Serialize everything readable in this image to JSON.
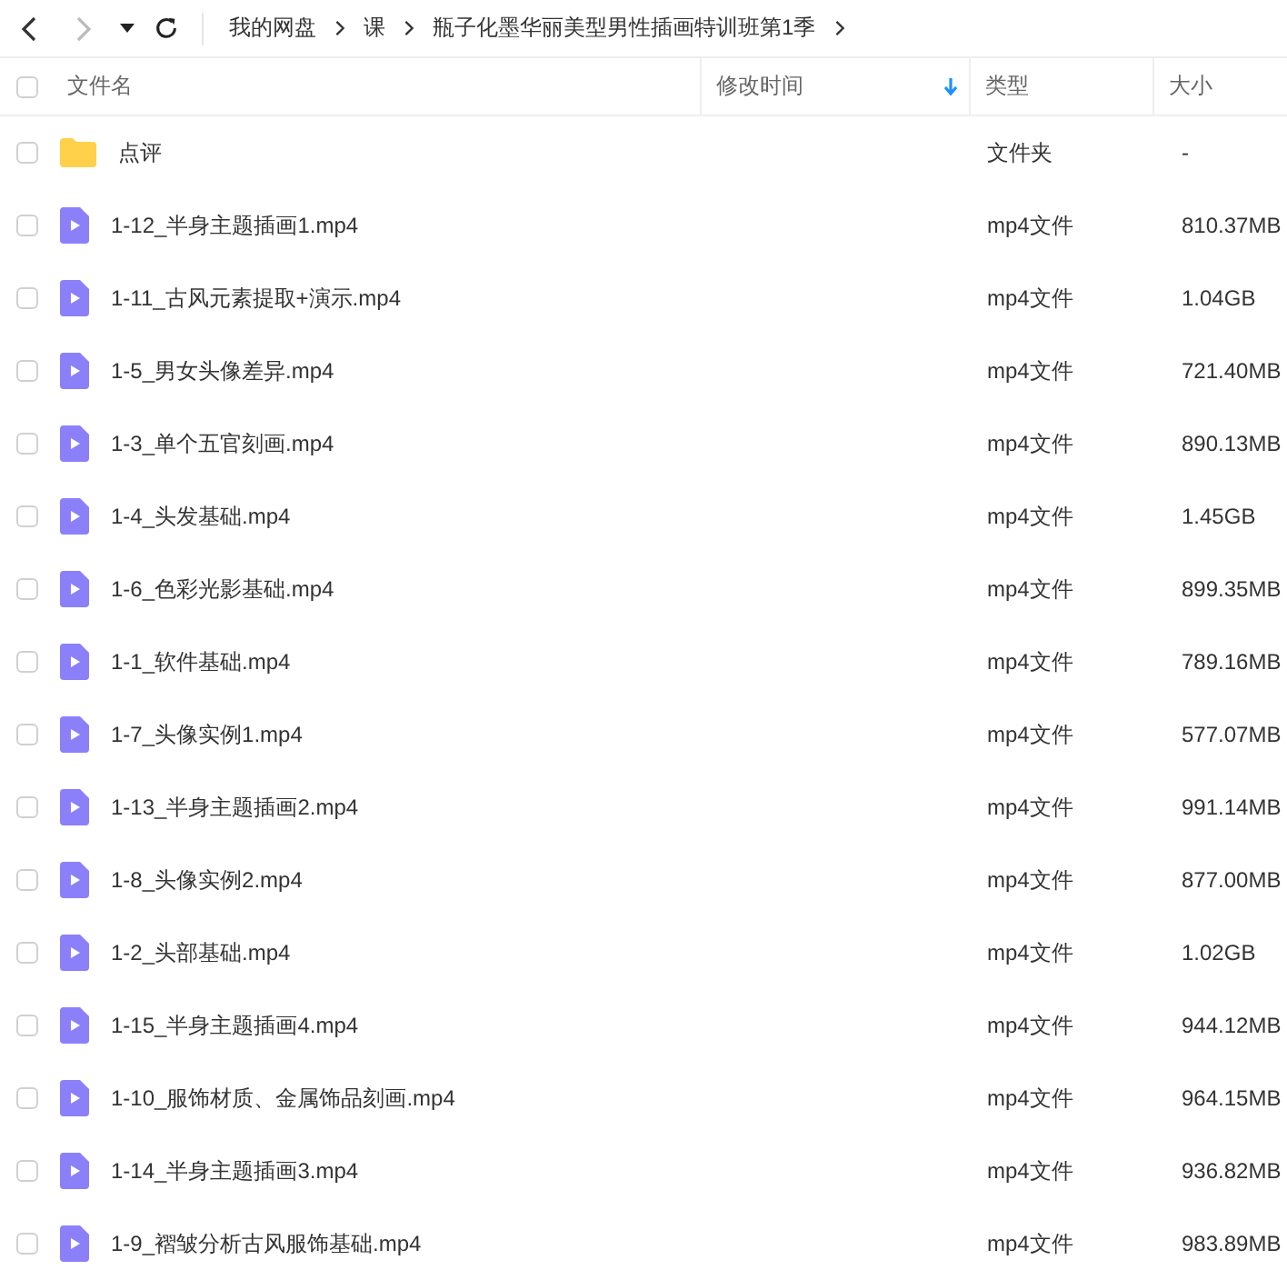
{
  "toolbar": {
    "back_disabled": false,
    "forward_disabled": true
  },
  "breadcrumb": [
    "我的网盘",
    "课",
    "瓶子化墨华丽美型男性插画特训班第1季"
  ],
  "select_all": false,
  "columns": [
    {
      "label": "文件名",
      "sorted": false
    },
    {
      "label": "修改时间",
      "sorted": true
    },
    {
      "label": "类型",
      "sorted": false
    },
    {
      "label": "大小",
      "sorted": false
    }
  ],
  "rows": [
    {
      "kind": "folder",
      "name": "点评",
      "type": "文件夹",
      "size": "-",
      "checked": false
    },
    {
      "kind": "video",
      "name": "1-12_半身主题插画1.mp4",
      "type": "mp4文件",
      "size": "810.37MB",
      "checked": false
    },
    {
      "kind": "video",
      "name": "1-11_古风元素提取+演示.mp4",
      "type": "mp4文件",
      "size": "1.04GB",
      "checked": false
    },
    {
      "kind": "video",
      "name": "1-5_男女头像差异.mp4",
      "type": "mp4文件",
      "size": "721.40MB",
      "checked": false
    },
    {
      "kind": "video",
      "name": "1-3_单个五官刻画.mp4",
      "type": "mp4文件",
      "size": "890.13MB",
      "checked": false
    },
    {
      "kind": "video",
      "name": "1-4_头发基础.mp4",
      "type": "mp4文件",
      "size": "1.45GB",
      "checked": false
    },
    {
      "kind": "video",
      "name": "1-6_色彩光影基础.mp4",
      "type": "mp4文件",
      "size": "899.35MB",
      "checked": false
    },
    {
      "kind": "video",
      "name": "1-1_软件基础.mp4",
      "type": "mp4文件",
      "size": "789.16MB",
      "checked": false
    },
    {
      "kind": "video",
      "name": "1-7_头像实例1.mp4",
      "type": "mp4文件",
      "size": "577.07MB",
      "checked": false
    },
    {
      "kind": "video",
      "name": "1-13_半身主题插画2.mp4",
      "type": "mp4文件",
      "size": "991.14MB",
      "checked": false
    },
    {
      "kind": "video",
      "name": "1-8_头像实例2.mp4",
      "type": "mp4文件",
      "size": "877.00MB",
      "checked": false
    },
    {
      "kind": "video",
      "name": "1-2_头部基础.mp4",
      "type": "mp4文件",
      "size": "1.02GB",
      "checked": false
    },
    {
      "kind": "video",
      "name": "1-15_半身主题插画4.mp4",
      "type": "mp4文件",
      "size": "944.12MB",
      "checked": false
    },
    {
      "kind": "video",
      "name": "1-10_服饰材质、金属饰品刻画.mp4",
      "type": "mp4文件",
      "size": "964.15MB",
      "checked": false
    },
    {
      "kind": "video",
      "name": "1-14_半身主题插画3.mp4",
      "type": "mp4文件",
      "size": "936.82MB",
      "checked": false
    },
    {
      "kind": "video",
      "name": "1-9_褶皱分析古风服饰基础.mp4",
      "type": "mp4文件",
      "size": "983.89MB",
      "checked": false
    }
  ]
}
